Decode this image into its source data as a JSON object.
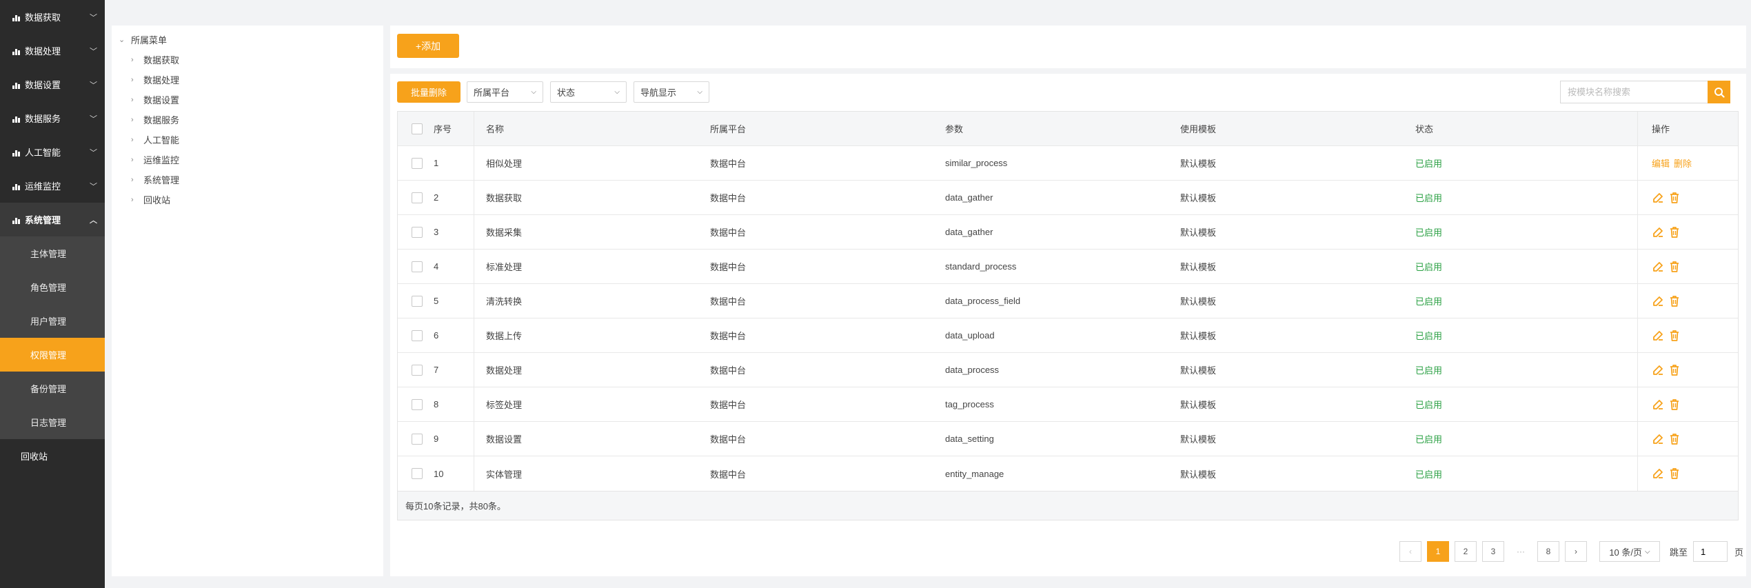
{
  "colors": {
    "accent": "#f7a21b",
    "sidebar_bg": "#2b2b2b",
    "success": "#2aa043"
  },
  "sidebar": {
    "items": [
      {
        "label": "数据获取",
        "icon": "bar-chart-icon"
      },
      {
        "label": "数据处理",
        "icon": "bar-chart-icon"
      },
      {
        "label": "数据设置",
        "icon": "bar-chart-icon"
      },
      {
        "label": "数据服务",
        "icon": "bar-chart-icon"
      },
      {
        "label": "人工智能",
        "icon": "bar-chart-icon"
      },
      {
        "label": "运维监控",
        "icon": "bar-chart-icon"
      }
    ],
    "open_group": {
      "label": "系统管理",
      "icon": "bar-chart-icon"
    },
    "sub_items": [
      {
        "label": "主体管理"
      },
      {
        "label": "角色管理"
      },
      {
        "label": "用户管理"
      },
      {
        "label": "权限管理",
        "active": true
      },
      {
        "label": "备份管理"
      },
      {
        "label": "日志管理"
      }
    ],
    "recycle": "回收站"
  },
  "tree": {
    "root": "所属菜单",
    "children": [
      "数据获取",
      "数据处理",
      "数据设置",
      "数据服务",
      "人工智能",
      "运维监控",
      "系统管理",
      "回收站"
    ]
  },
  "toolbar": {
    "add_label": "+添加"
  },
  "filters": {
    "batch_delete": "批量删除",
    "platform": "所属平台",
    "status": "状态",
    "nav_display": "导航显示",
    "search_placeholder": "按模块名称搜索"
  },
  "table": {
    "headers": {
      "index": "序号",
      "name": "名称",
      "platform": "所属平台",
      "param": "参数",
      "template": "使用模板",
      "status": "状态",
      "ops": "操作"
    },
    "rows": [
      {
        "index": "1",
        "name": "相似处理",
        "platform": "数据中台",
        "param": "similar_process",
        "template": "默认模板",
        "status": "已启用",
        "edit": "编辑",
        "delete": "删除"
      },
      {
        "index": "2",
        "name": "数据获取",
        "platform": "数据中台",
        "param": "data_gather",
        "template": "默认模板",
        "status": "已启用"
      },
      {
        "index": "3",
        "name": "数据采集",
        "platform": "数据中台",
        "param": "data_gather",
        "template": "默认模板",
        "status": "已启用"
      },
      {
        "index": "4",
        "name": "标准处理",
        "platform": "数据中台",
        "param": "standard_process",
        "template": "默认模板",
        "status": "已启用"
      },
      {
        "index": "5",
        "name": "清洗转换",
        "platform": "数据中台",
        "param": "data_process_field",
        "template": "默认模板",
        "status": "已启用"
      },
      {
        "index": "6",
        "name": "数据上传",
        "platform": "数据中台",
        "param": "data_upload",
        "template": "默认模板",
        "status": "已启用"
      },
      {
        "index": "7",
        "name": "数据处理",
        "platform": "数据中台",
        "param": "data_process",
        "template": "默认模板",
        "status": "已启用"
      },
      {
        "index": "8",
        "name": "标签处理",
        "platform": "数据中台",
        "param": "tag_process",
        "template": "默认模板",
        "status": "已启用"
      },
      {
        "index": "9",
        "name": "数据设置",
        "platform": "数据中台",
        "param": "data_setting",
        "template": "默认模板",
        "status": "已启用"
      },
      {
        "index": "10",
        "name": "实体管理",
        "platform": "数据中台",
        "param": "entity_manage",
        "template": "默认模板",
        "status": "已启用"
      }
    ],
    "footer": "每页10条记录，共80条。"
  },
  "pagination": {
    "prev": "‹",
    "pages": [
      "1",
      "2",
      "3"
    ],
    "ellipsis": "···",
    "last": "8",
    "next": "›",
    "current": "1",
    "page_size": "10 条/页",
    "jump_label": "跳至",
    "jump_value": "1",
    "page_unit": "页"
  }
}
